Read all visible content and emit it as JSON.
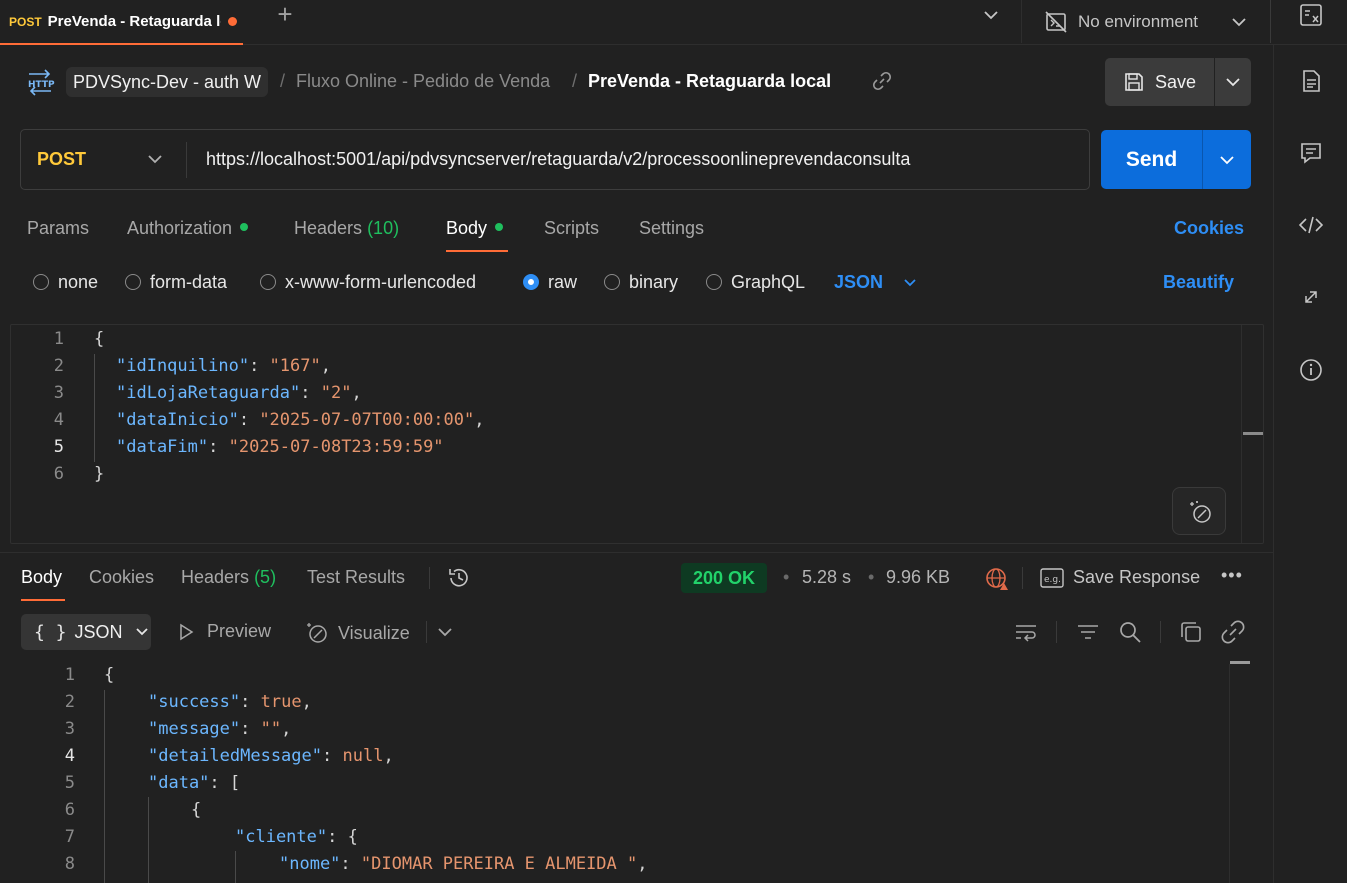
{
  "tab": {
    "method": "POST",
    "title": "PreVenda - Retaguarda local"
  },
  "environment": {
    "label": "No environment"
  },
  "breadcrumb": {
    "workspace": "PDVSync-Dev - auth W",
    "sep": "/",
    "folder": "Fluxo Online - Pedido de Venda",
    "request": "PreVenda - Retaguarda local"
  },
  "save": {
    "label": "Save"
  },
  "request": {
    "method": "POST",
    "url": "https://localhost:5001/api/pdvsyncserver/retaguarda/v2/processoonlineprevendaconsulta",
    "send_label": "Send"
  },
  "req_tabs": {
    "params": "Params",
    "authorization": "Authorization",
    "headers": "Headers",
    "headers_count": "(10)",
    "body": "Body",
    "scripts": "Scripts",
    "settings": "Settings",
    "cookies": "Cookies"
  },
  "body_types": {
    "none": "none",
    "form_data": "form-data",
    "urlencoded": "x-www-form-urlencoded",
    "raw": "raw",
    "binary": "binary",
    "graphql": "GraphQL",
    "selected_format": "JSON",
    "beautify": "Beautify"
  },
  "request_body": {
    "line_numbers": [
      "1",
      "2",
      "3",
      "4",
      "5",
      "6"
    ],
    "open": "{",
    "close": "}",
    "fields": [
      {
        "key": "\"idInquilino\"",
        "value": "\"167\""
      },
      {
        "key": "\"idLojaRetaguarda\"",
        "value": "\"2\""
      },
      {
        "key": "\"dataInicio\"",
        "value": "\"2025-07-07T00:00:00\""
      },
      {
        "key": "\"dataFim\"",
        "value": "\"2025-07-08T23:59:59\""
      }
    ]
  },
  "resp_tabs": {
    "body": "Body",
    "cookies": "Cookies",
    "headers": "Headers",
    "headers_count": "(5)",
    "test_results": "Test Results"
  },
  "response_meta": {
    "status": "200 OK",
    "dot": "•",
    "time": "5.28 s",
    "size": "9.96 KB",
    "save_response": "Save Response",
    "more": "•••"
  },
  "response_toolbar": {
    "format_braces": "{ }",
    "format": "JSON",
    "preview": "Preview",
    "visualize": "Visualize"
  },
  "response_body": {
    "line_numbers": [
      "1",
      "2",
      "3",
      "4",
      "5",
      "6",
      "7",
      "8"
    ],
    "l1": "{",
    "success_key": "\"success\"",
    "success_val": "true",
    "message_key": "\"message\"",
    "message_val": "\"\"",
    "detailed_key": "\"detailedMessage\"",
    "detailed_val": "null",
    "data_key": "\"data\"",
    "data_open": "[",
    "obj_open": "{",
    "cliente_key": "\"cliente\"",
    "cliente_open": "{",
    "nome_key": "\"nome\"",
    "nome_val": "\"DIOMAR PEREIRA E ALMEIDA \""
  },
  "colors": {
    "accent": "#ff6c37",
    "send": "#0c6ddc",
    "link": "#2e8ef5",
    "method": "#ffc93a",
    "ok": "#22d26a",
    "json_key": "#6cb7ff",
    "json_value": "#e5956e"
  }
}
